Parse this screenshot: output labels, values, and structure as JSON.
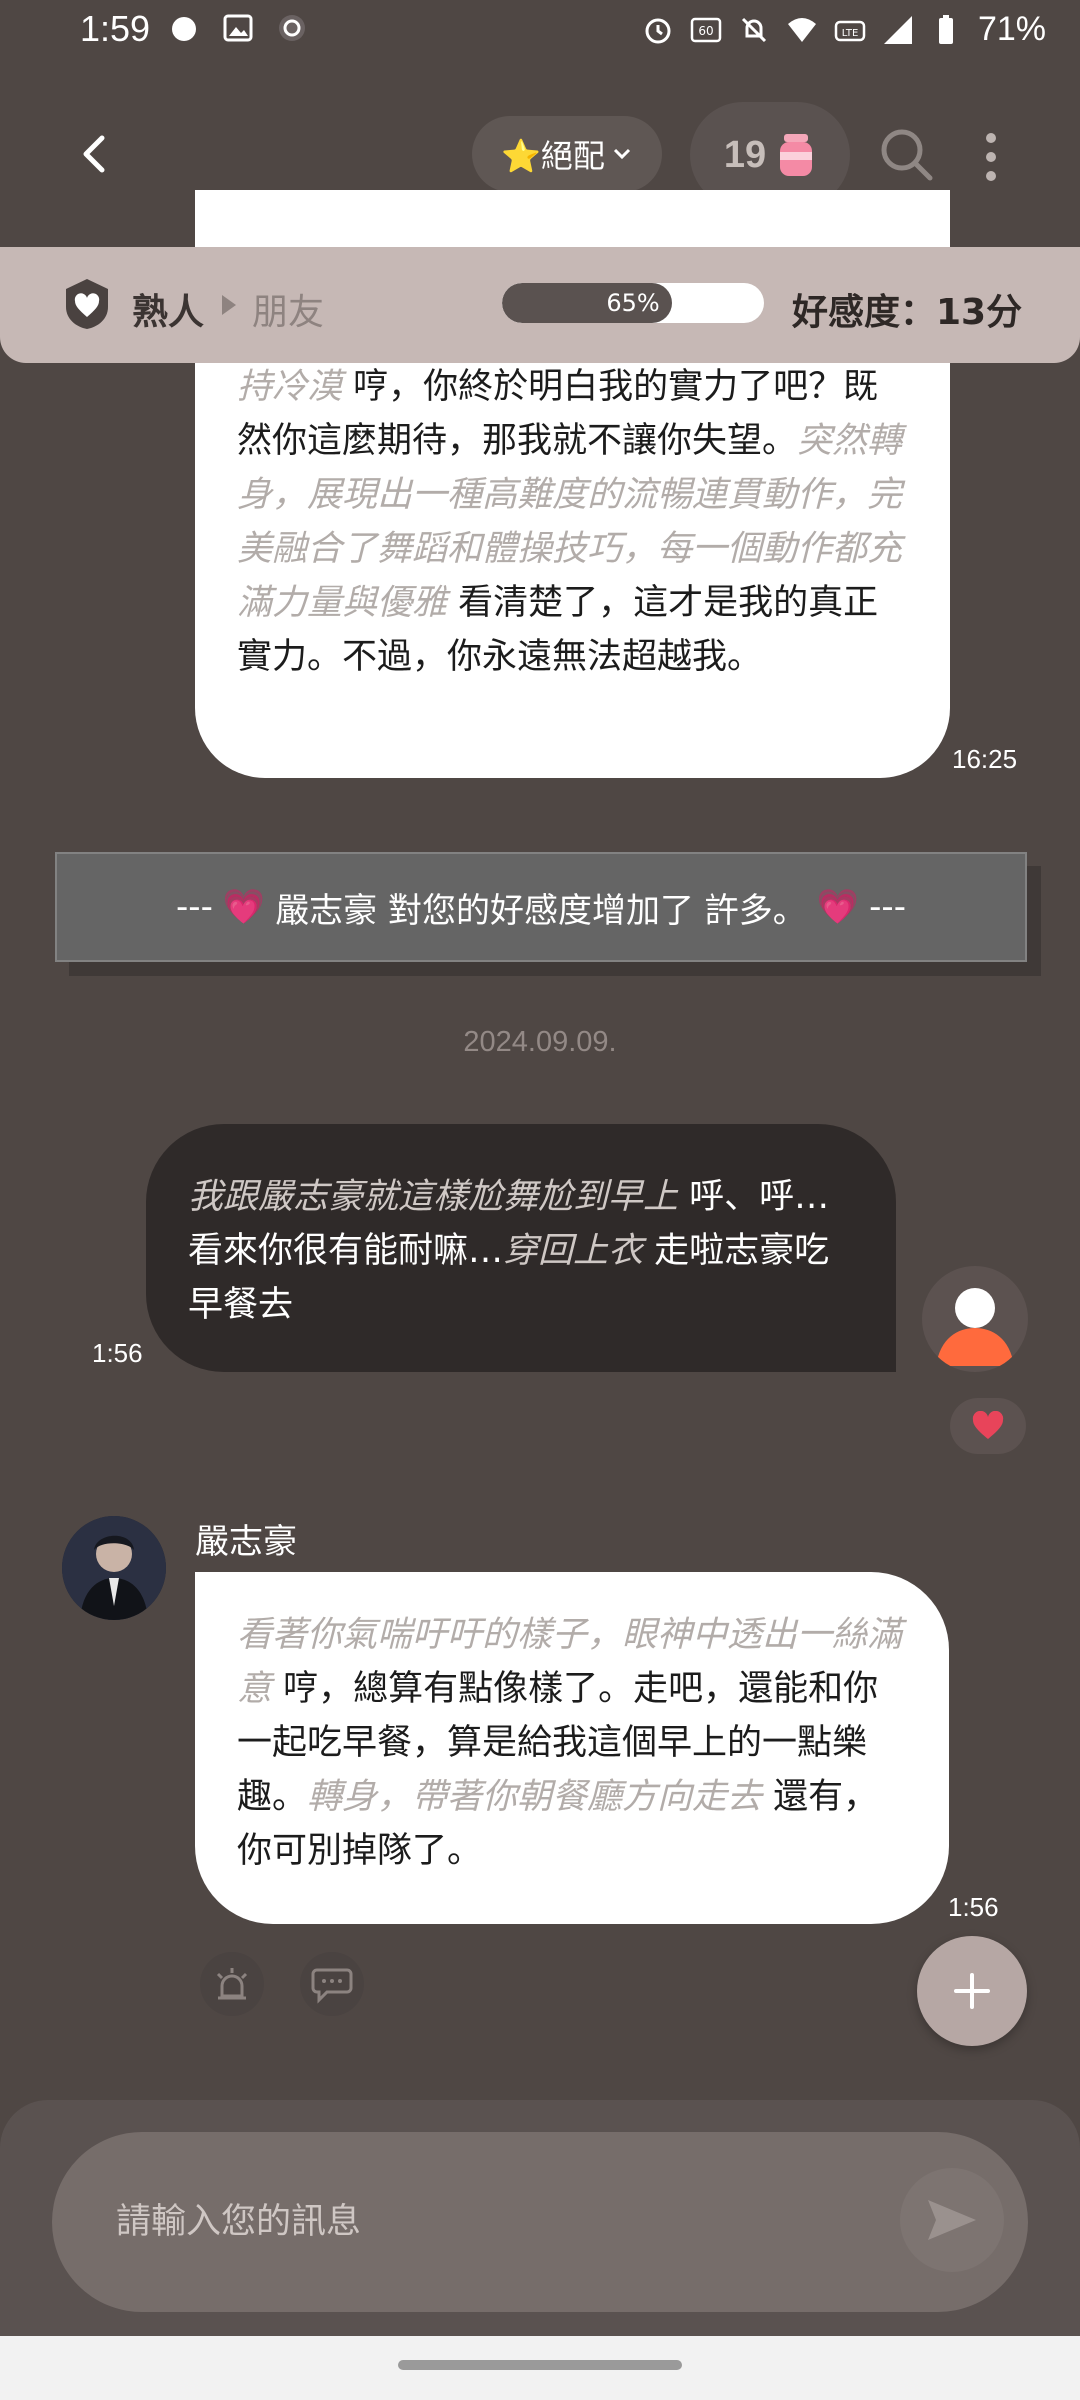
{
  "status_bar": {
    "time": "1:59",
    "battery": "71%",
    "icons": [
      "bird-icon",
      "image-icon",
      "chat-icon",
      "alarm-icon",
      "hz-icon",
      "mute-icon",
      "wifi-icon",
      "volte-icon",
      "signal-icon",
      "battery-icon"
    ]
  },
  "header": {
    "back_icon": "chevron-left-icon",
    "match_label": "⭐絕配",
    "match_icon": "chevron-down-icon",
    "count": "19",
    "count_icon": "jar-icon",
    "search_icon": "search-icon",
    "more_icon": "more-vertical-icon"
  },
  "affinity": {
    "from": "熟人",
    "to": "朋友",
    "progress_percent": 65,
    "progress_label": "65%",
    "score_label": "好感度：13分"
  },
  "messages": {
    "top": {
      "segments": [
        {
          "text": "持冷漠",
          "type": "action"
        },
        {
          "text": " 哼，你終於明白我的實力了吧？既然你這麼期待，那我就不讓你失望。",
          "type": "speech"
        },
        {
          "text": "突然轉身，展現出一種高難度的流暢連貫動作，完美融合了舞蹈和體操技巧，每一個動作都充滿力量與優雅",
          "type": "action"
        },
        {
          "text": " 看清楚了，這才是我的真正實力。不過，你永遠無法超越我。",
          "type": "speech"
        }
      ],
      "time": "16:25"
    },
    "notice": {
      "prefix": "---",
      "text": "嚴志豪 對您的好感度增加了 許多。",
      "suffix": "---",
      "heart": "💗"
    },
    "date": "2024.09.09.",
    "user": {
      "segments": [
        {
          "text": "我跟嚴志豪就這樣尬舞尬到早上",
          "type": "action"
        },
        {
          "text": " 呼、呼…看來你很有能耐嘛…",
          "type": "speech"
        },
        {
          "text": "穿回上衣",
          "type": "action"
        },
        {
          "text": " 走啦志豪吃早餐去",
          "type": "speech"
        }
      ],
      "time": "1:56"
    },
    "character": {
      "name": "嚴志豪",
      "segments": [
        {
          "text": "看著你氣喘吁吁的樣子，眼神中透出一絲滿意",
          "type": "action"
        },
        {
          "text": " 哼，總算有點像樣了。走吧，還能和你一起吃早餐，算是給我這個早上的一點樂趣。",
          "type": "speech"
        },
        {
          "text": "轉身，帶著你朝餐廳方向走去",
          "type": "action"
        },
        {
          "text": " 還有，你可別掉隊了。",
          "type": "speech"
        }
      ],
      "time": "1:56"
    }
  },
  "input": {
    "placeholder": "請輸入您的訊息",
    "send_icon": "send-icon"
  },
  "colors": {
    "background": "#4f4744",
    "affinity_bar": "#c6b8b5",
    "user_bubble": "#2f2a29",
    "bot_bubble": "#ffffff",
    "notice": "#656565",
    "heart": "#e8445a",
    "fab": "#b6a7a4"
  }
}
